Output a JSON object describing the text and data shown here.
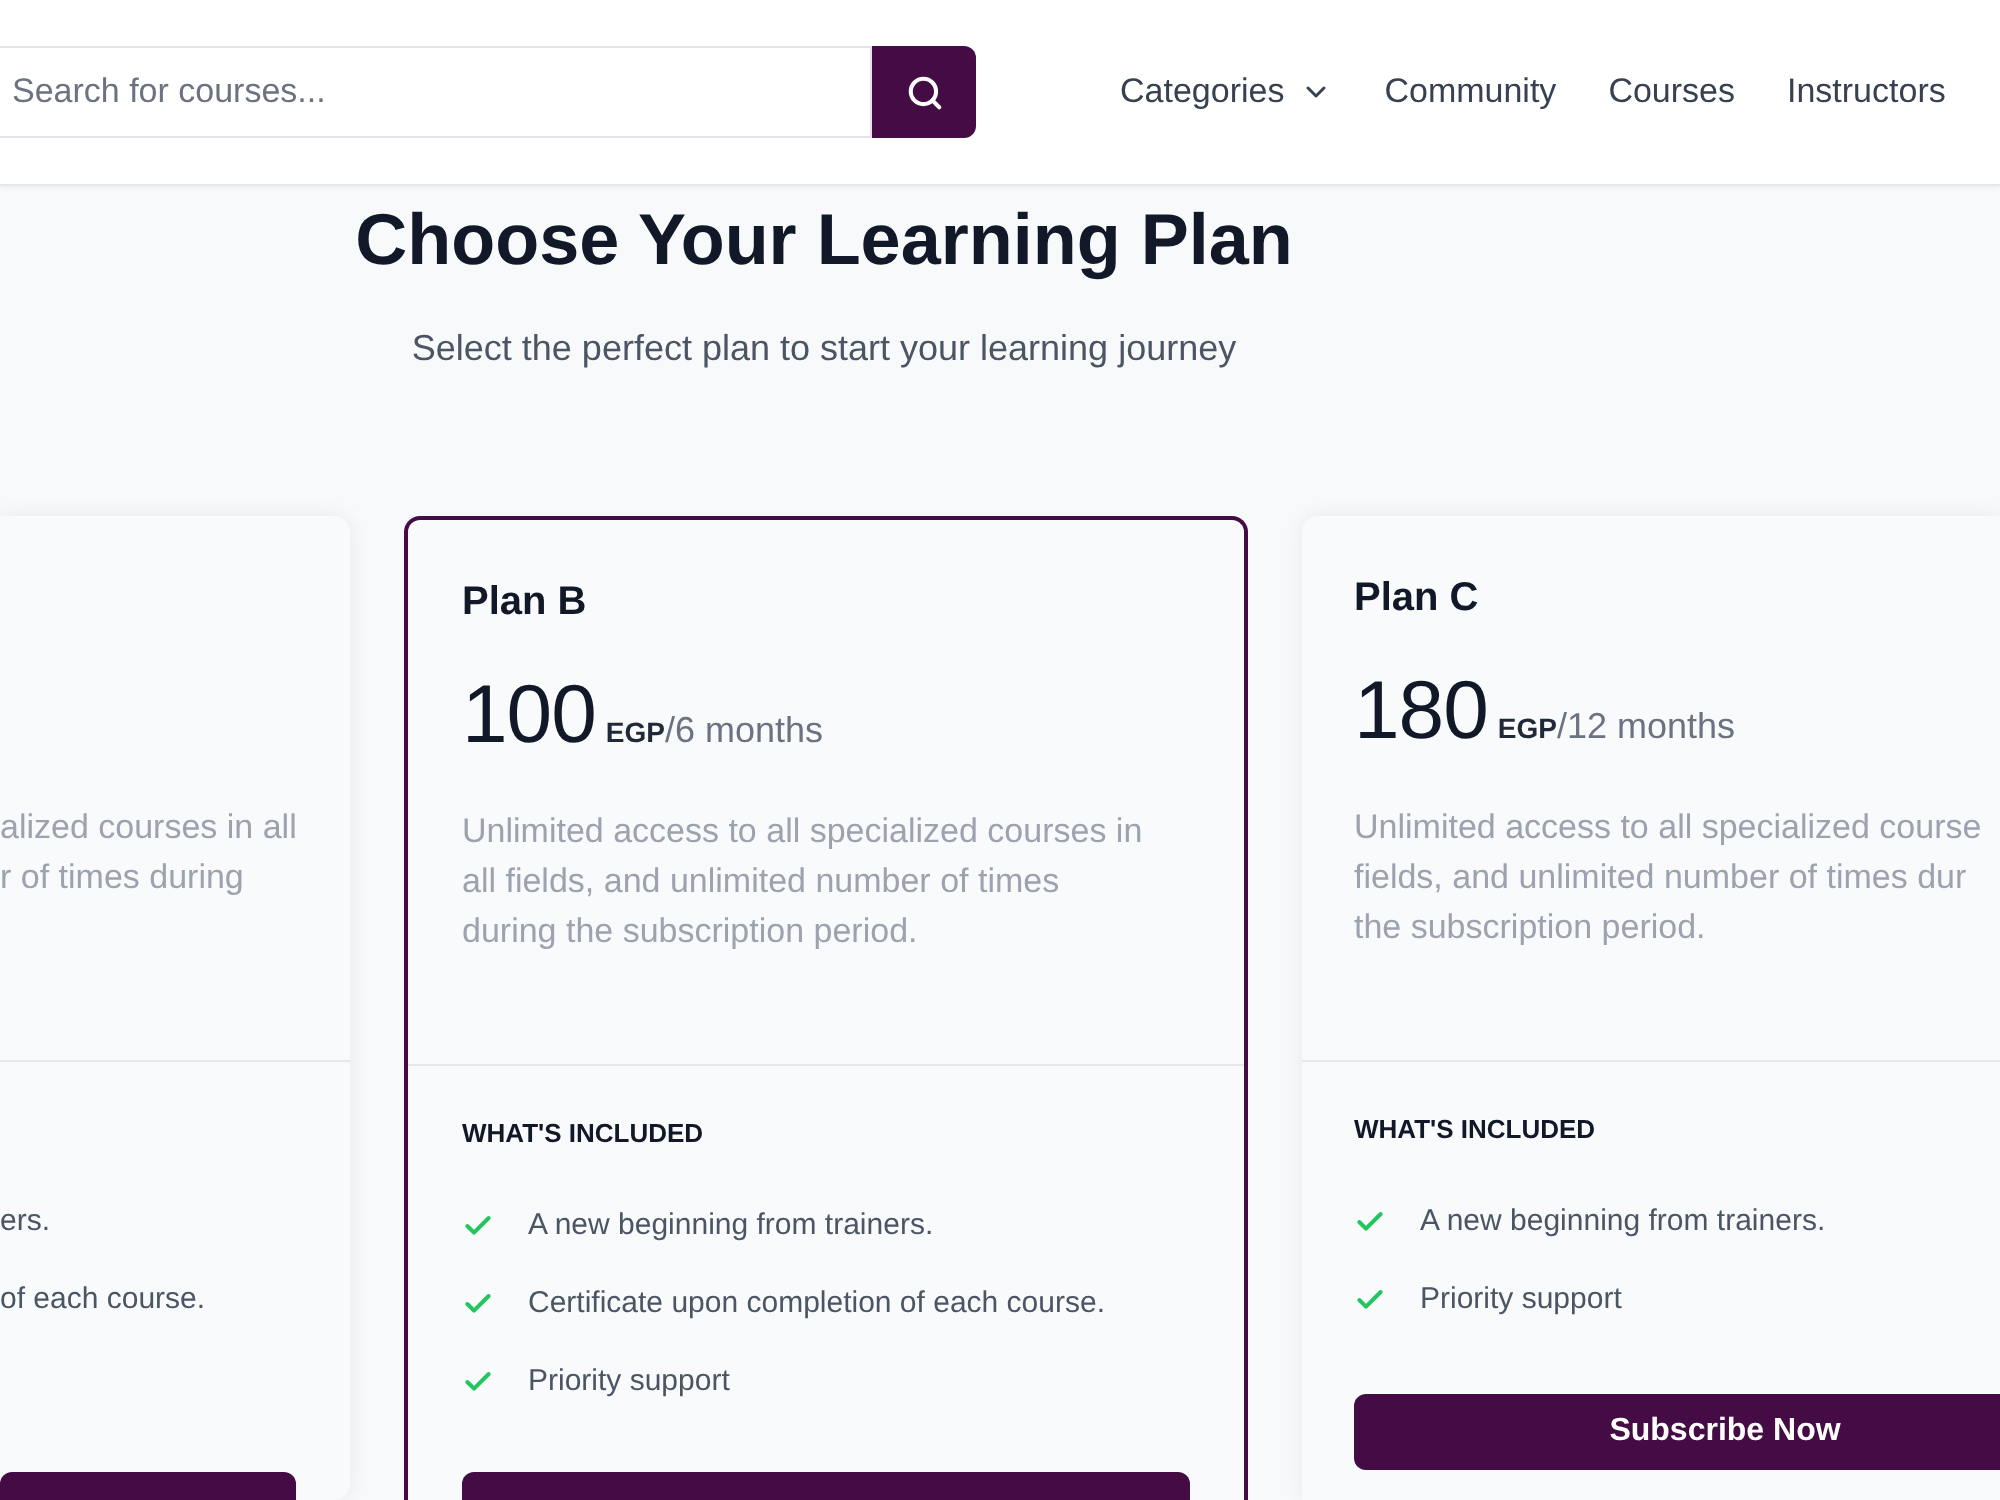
{
  "header": {
    "search": {
      "placeholder": "Search for courses..."
    },
    "nav": [
      {
        "label": "Categories",
        "kind": "dropdown"
      },
      {
        "label": "Community",
        "kind": "link"
      },
      {
        "label": "Courses",
        "kind": "link"
      },
      {
        "label": "Instructors",
        "kind": "link"
      }
    ]
  },
  "hero": {
    "title": "Choose Your Learning Plan",
    "subtitle": "Select the perfect plan to start your learning journey"
  },
  "plans": [
    {
      "kind": "cut_left",
      "selected": false,
      "description_lines": [
        "alized courses in all",
        "r of times during"
      ],
      "features": [
        "ers.",
        "of each course."
      ]
    },
    {
      "kind": "full",
      "selected": true,
      "title": "Plan B",
      "price": "100",
      "currency": "EGP",
      "period": "/6 months",
      "description_lines": [
        "Unlimited access to all specialized courses in",
        "all fields, and unlimited number of times",
        "during the subscription period."
      ],
      "included_heading": "WHAT'S INCLUDED",
      "features": [
        "A new beginning from trainers.",
        "Certificate upon completion of each course.",
        "Priority support"
      ]
    },
    {
      "kind": "cut_right",
      "selected": false,
      "title": "Plan C",
      "price": "180",
      "currency": "EGP",
      "period": "/12 months",
      "description_lines": [
        "Unlimited access to all specialized course",
        "fields, and unlimited number of times dur",
        "the subscription period."
      ],
      "included_heading": "WHAT'S INCLUDED",
      "features": [
        "A new beginning from trainers.",
        "Priority support"
      ],
      "button_label": "Subscribe Now"
    }
  ]
}
